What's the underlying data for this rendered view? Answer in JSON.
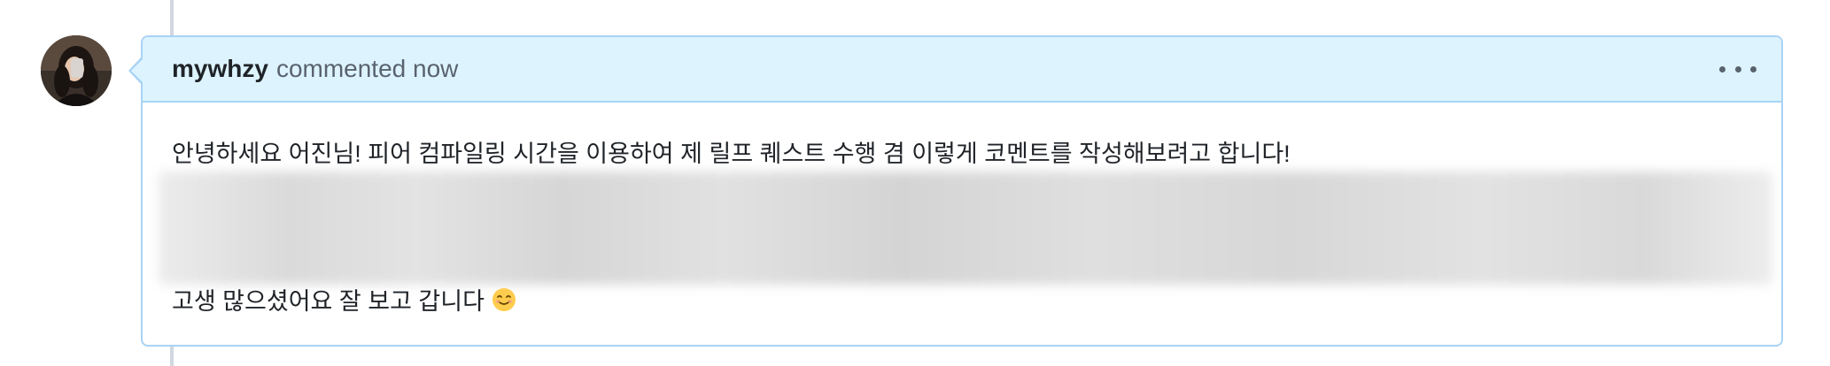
{
  "comment": {
    "author": "mywhzy",
    "action": "commented now",
    "body": {
      "line1": "안녕하세요 어진님! 피어 컴파일링 시간을 이용하여 제 릴프 퀘스트 수행 겸 이렇게 코멘트를 작성해보려고 합니다!",
      "line2": "고생 많으셨어요 잘 보고 갑니다"
    },
    "emoji": "smiling-face-icon"
  },
  "colors": {
    "header_bg": "#ddf4ff",
    "border": "#a9d3f5",
    "author_text": "#1f2328",
    "muted_text": "#59636e"
  }
}
